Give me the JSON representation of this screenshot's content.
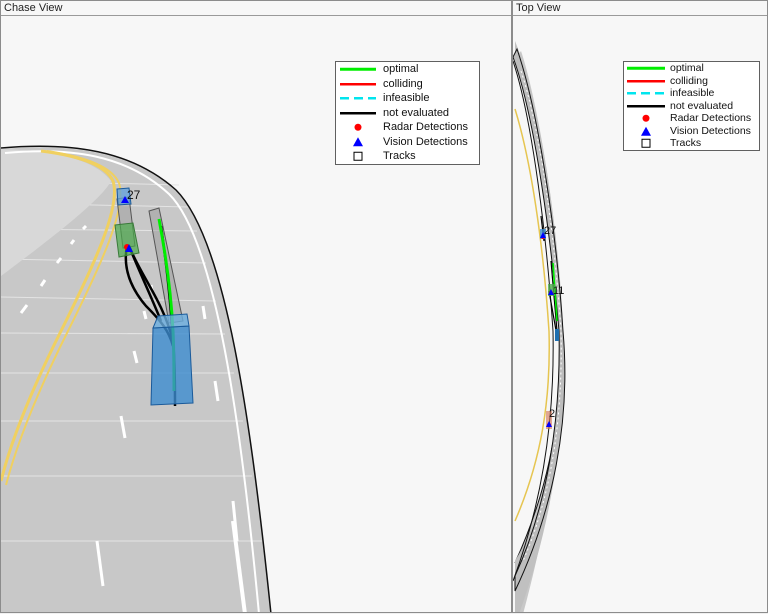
{
  "chase_view": {
    "title": "Chase View",
    "track_labels": [
      "27"
    ]
  },
  "top_view": {
    "title": "Top View",
    "track_labels": [
      "27",
      "11",
      "2"
    ]
  },
  "legend": {
    "entries": [
      {
        "label": "optimal",
        "color": "#00ee00",
        "style": "solid-line"
      },
      {
        "label": "colliding",
        "color": "#ff0000",
        "style": "solid-line"
      },
      {
        "label": "infeasible",
        "color": "#00e5ee",
        "style": "dashed-line"
      },
      {
        "label": "not evaluated",
        "color": "#000000",
        "style": "solid-line"
      },
      {
        "label": "Radar Detections",
        "color": "#ff0000",
        "style": "circle-marker"
      },
      {
        "label": "Vision Detections",
        "color": "#0000ff",
        "style": "triangle-marker"
      },
      {
        "label": "Tracks",
        "color": "#000000",
        "style": "square-marker"
      }
    ]
  }
}
